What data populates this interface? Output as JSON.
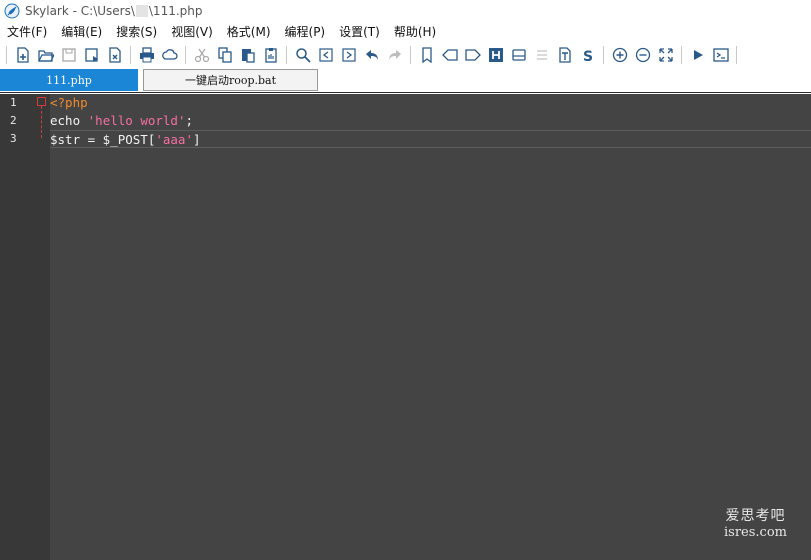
{
  "titlebar": {
    "app_name": "Skylark",
    "title_prefix": "Skylark - C:\\Users\\",
    "title_suffix": "\\111.php",
    "icon": "skylark-feather-icon"
  },
  "menubar": {
    "items": [
      {
        "label": "文件(F)"
      },
      {
        "label": "编辑(E)"
      },
      {
        "label": "搜索(S)"
      },
      {
        "label": "视图(V)"
      },
      {
        "label": "格式(M)"
      },
      {
        "label": "编程(P)"
      },
      {
        "label": "设置(T)"
      },
      {
        "label": "帮助(H)"
      }
    ]
  },
  "toolbar": {
    "icons": [
      "new-file-icon",
      "open-folder-icon",
      "save-icon",
      "save-as-icon",
      "close-file-icon",
      "print-icon",
      "cloud-icon",
      "cut-icon",
      "copy-icon",
      "paste-icon",
      "clipboard-icon",
      "search-icon",
      "prev-icon",
      "next-icon",
      "undo-icon",
      "redo-icon",
      "bookmark-icon",
      "bookmark-prev-icon",
      "bookmark-next-icon",
      "header-icon",
      "hdd-icon",
      "list-icon",
      "text-icon",
      "s-icon",
      "zoom-in-icon",
      "zoom-out-icon",
      "fullscreen-icon",
      "run-icon",
      "console-icon"
    ]
  },
  "tabs": [
    {
      "label": "111.php",
      "active": true
    },
    {
      "label": "一键启动roop.bat",
      "active": false
    }
  ],
  "editor": {
    "line_numbers": [
      "1",
      "2",
      "3"
    ],
    "lines": {
      "l1": {
        "tag": "<?php"
      },
      "l2": {
        "a": "echo ",
        "str": "'hello world'",
        "b": ";"
      },
      "l3": {
        "a": "$str = $_POST[",
        "str": "'aaa'",
        "b": "]"
      }
    },
    "colors": {
      "background": "#444444",
      "gutter": "#383838",
      "php_tag": "#f08a2c",
      "string": "#f56fa2",
      "plain": "#f2f2f2",
      "fold_marker": "#d23b3b"
    }
  },
  "watermark": {
    "line1": "爱思考吧",
    "line2": "isres.com"
  }
}
